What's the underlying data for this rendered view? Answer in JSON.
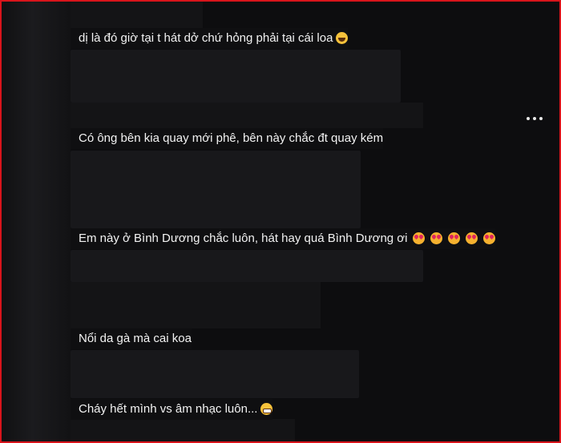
{
  "comments": [
    {
      "text": "dị là đó giờ tại t hát dở chứ hỏng phải tại cái loa",
      "emoji": "laughing-emoji"
    },
    {
      "text": "Có ông bên kia quay mới phê, bên này chắc đt quay kém"
    },
    {
      "text": "Em này ở Bình Dương chắc luôn, hát hay quá Bình Dương ơi",
      "emoji": "smiling-face-with-hearts-emoji",
      "emoji_count": 5
    },
    {
      "text": "Nổi da gà mà cai koa"
    },
    {
      "text": "Cháy hết mình vs âm nhạc luôn...",
      "emoji": "grinning-emoji"
    }
  ],
  "more_menu": {
    "icon": "more-horizontal-icon"
  },
  "colors": {
    "border": "#d8141b",
    "background": "#0d0d0f",
    "text": "#f2f2f2"
  }
}
